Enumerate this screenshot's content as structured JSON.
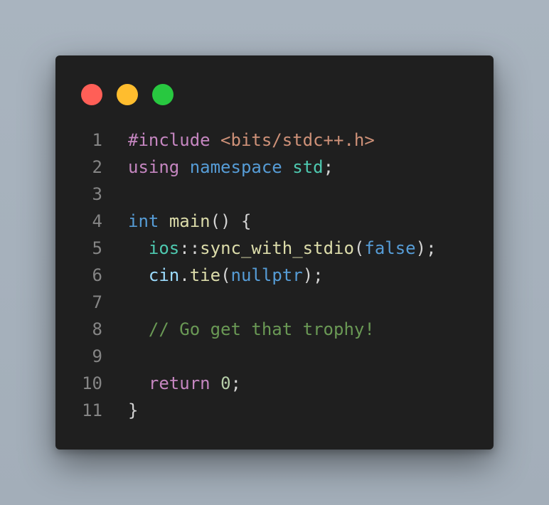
{
  "window": {
    "controls": [
      {
        "name": "close",
        "color": "#ff5f57"
      },
      {
        "name": "minimize",
        "color": "#ffbd2e"
      },
      {
        "name": "maximize",
        "color": "#28c840"
      }
    ]
  },
  "code": {
    "language": "cpp",
    "lines": [
      {
        "number": "1",
        "tokens": [
          {
            "text": "#include",
            "kind": "directive"
          },
          {
            "text": " ",
            "kind": "punc"
          },
          {
            "text": "<bits/stdc++.h>",
            "kind": "string"
          }
        ]
      },
      {
        "number": "2",
        "tokens": [
          {
            "text": "using",
            "kind": "keyword"
          },
          {
            "text": " ",
            "kind": "punc"
          },
          {
            "text": "namespace",
            "kind": "blue"
          },
          {
            "text": " ",
            "kind": "punc"
          },
          {
            "text": "std",
            "kind": "type"
          },
          {
            "text": ";",
            "kind": "punc"
          }
        ]
      },
      {
        "number": "3",
        "tokens": []
      },
      {
        "number": "4",
        "tokens": [
          {
            "text": "int",
            "kind": "blue"
          },
          {
            "text": " ",
            "kind": "punc"
          },
          {
            "text": "main",
            "kind": "function"
          },
          {
            "text": "() {",
            "kind": "punc"
          }
        ]
      },
      {
        "number": "5",
        "tokens": [
          {
            "text": "  ",
            "kind": "punc"
          },
          {
            "text": "ios",
            "kind": "type"
          },
          {
            "text": "::",
            "kind": "punc"
          },
          {
            "text": "sync_with_stdio",
            "kind": "function"
          },
          {
            "text": "(",
            "kind": "punc"
          },
          {
            "text": "false",
            "kind": "blue"
          },
          {
            "text": ");",
            "kind": "punc"
          }
        ]
      },
      {
        "number": "6",
        "tokens": [
          {
            "text": "  ",
            "kind": "punc"
          },
          {
            "text": "cin",
            "kind": "variable"
          },
          {
            "text": ".",
            "kind": "punc"
          },
          {
            "text": "tie",
            "kind": "function"
          },
          {
            "text": "(",
            "kind": "punc"
          },
          {
            "text": "nullptr",
            "kind": "blue"
          },
          {
            "text": ");",
            "kind": "punc"
          }
        ]
      },
      {
        "number": "7",
        "tokens": []
      },
      {
        "number": "8",
        "tokens": [
          {
            "text": "  ",
            "kind": "punc"
          },
          {
            "text": "// Go get that trophy!",
            "kind": "comment"
          }
        ]
      },
      {
        "number": "9",
        "tokens": []
      },
      {
        "number": "10",
        "tokens": [
          {
            "text": "  ",
            "kind": "punc"
          },
          {
            "text": "return",
            "kind": "keyword"
          },
          {
            "text": " ",
            "kind": "punc"
          },
          {
            "text": "0",
            "kind": "number"
          },
          {
            "text": ";",
            "kind": "punc"
          }
        ]
      },
      {
        "number": "11",
        "tokens": [
          {
            "text": "}",
            "kind": "punc"
          }
        ]
      }
    ]
  },
  "colors": {
    "background": "#a6b1bc",
    "editor_background": "#1f1f1f",
    "line_number": "#858585",
    "directive": "#c586c0",
    "string": "#ce9178",
    "keyword": "#c586c0",
    "blue": "#569cd6",
    "type": "#4ec9b0",
    "function": "#dcdcaa",
    "variable": "#9cdcfe",
    "number": "#b5cea8",
    "comment": "#6a9955",
    "punctuation": "#d4d4d4"
  }
}
